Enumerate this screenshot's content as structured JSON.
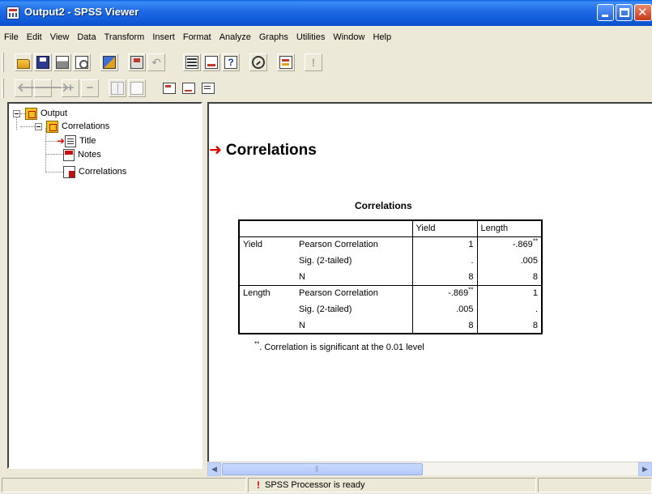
{
  "window": {
    "title": "Output2 - SPSS Viewer",
    "minimize_icon": "minimize-icon",
    "maximize_icon": "maximize-icon",
    "close_icon": "close-icon"
  },
  "menu": [
    "File",
    "Edit",
    "View",
    "Data",
    "Transform",
    "Insert",
    "Format",
    "Analyze",
    "Graphs",
    "Utilities",
    "Window",
    "Help"
  ],
  "toolbar1_icons": [
    "open-icon",
    "save-icon",
    "print-icon",
    "print-preview-icon",
    "export-icon",
    "dialog-recall-icon",
    "undo-icon",
    "goto-data-icon",
    "variables-icon",
    "variable-info-icon",
    "scripts-icon",
    "designate-window-icon",
    "warning-icon"
  ],
  "toolbar2_icons": [
    "promote-icon",
    "demote-icon",
    "expand-icon",
    "collapse-icon",
    "show-icon",
    "hide-icon",
    "insert-heading-icon",
    "insert-title-icon",
    "insert-text-icon"
  ],
  "tree": {
    "root": "Output",
    "group": "Correlations",
    "items": [
      "Title",
      "Notes",
      "Correlations"
    ]
  },
  "output": {
    "heading": "Correlations",
    "table_title": "Correlations",
    "columns": [
      "Yield",
      "Length"
    ],
    "rows": [
      {
        "var": "Yield",
        "stat": "Pearson Correlation",
        "yield": "1",
        "length": "-.869",
        "length_sup": "**"
      },
      {
        "var": "",
        "stat": "Sig. (2-tailed)",
        "yield": ".",
        "length": ".005"
      },
      {
        "var": "",
        "stat": "N",
        "yield": "8",
        "length": "8"
      },
      {
        "var": "Length",
        "stat": "Pearson Correlation",
        "yield": "-.869",
        "yield_sup": "**",
        "length": "1"
      },
      {
        "var": "",
        "stat": "Sig. (2-tailed)",
        "yield": ".005",
        "length": "."
      },
      {
        "var": "",
        "stat": "N",
        "yield": "8",
        "length": "8"
      }
    ],
    "footnote_mark": "**",
    "footnote_text": ". Correlation is significant at the 0.01 level"
  },
  "status": {
    "processor": "SPSS Processor  is ready"
  },
  "colors": {
    "titlebar": "#0e58d6",
    "accent_red": "#e00000",
    "background": "#ece9d8"
  }
}
